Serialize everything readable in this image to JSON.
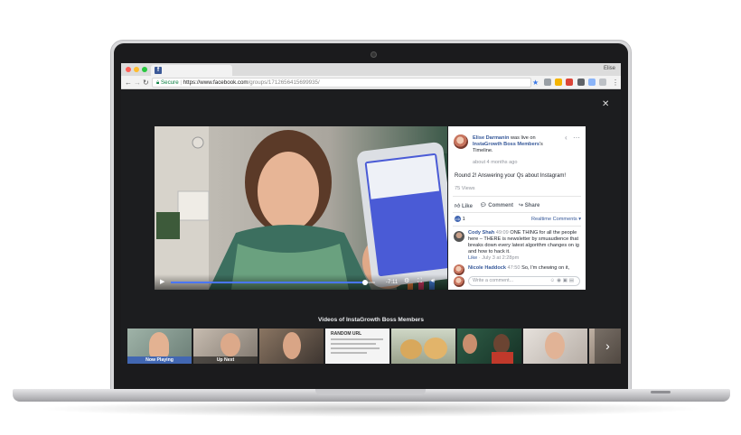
{
  "browser": {
    "user_name": "Elise",
    "secure_label": "Secure",
    "url_host": "https://www.facebook.com",
    "url_path": "/groups/1712656415699935/",
    "colors": {
      "close": "#ff5f57",
      "minimize": "#febc2e",
      "maximize": "#28c840",
      "favicon": "#3b5998"
    }
  },
  "video": {
    "time_remaining": "-7:11",
    "progress_fraction": 0.95
  },
  "post": {
    "author": "Elise Darmanin",
    "was_live_on": "was live on",
    "group_name": "InstaGrowth Boss Members",
    "timeline": "'s Timeline.",
    "time_ago": "about 4 months ago",
    "title": "Round 2! Answering your Qs about Instagram!",
    "views": "75 Views",
    "actions": {
      "like": "Like",
      "comment": "Comment",
      "share": "Share"
    },
    "reaction_count": "1",
    "comment_filter": "Realtime Comments ▾",
    "comments": [
      {
        "author": "Cody Shah",
        "timestamp": "49:09",
        "text": "ONE THING for all the people here – THERE is newsletter by smuaudience that breaks down every latest algorithm changes on ig and how to hack it.",
        "meta_like": "Like",
        "meta_date": "· July 3 at 2:28pm"
      },
      {
        "author": "Nicole Haddock",
        "timestamp": "47:50",
        "text": "So, I'm chewing on it,"
      }
    ],
    "comment_placeholder": "Write a comment..."
  },
  "strip": {
    "title": "Videos of InstaGrowth Boss Members",
    "now_playing": "Now Playing",
    "up_next": "Up Next",
    "doc_heading": "RANDOM URL"
  }
}
